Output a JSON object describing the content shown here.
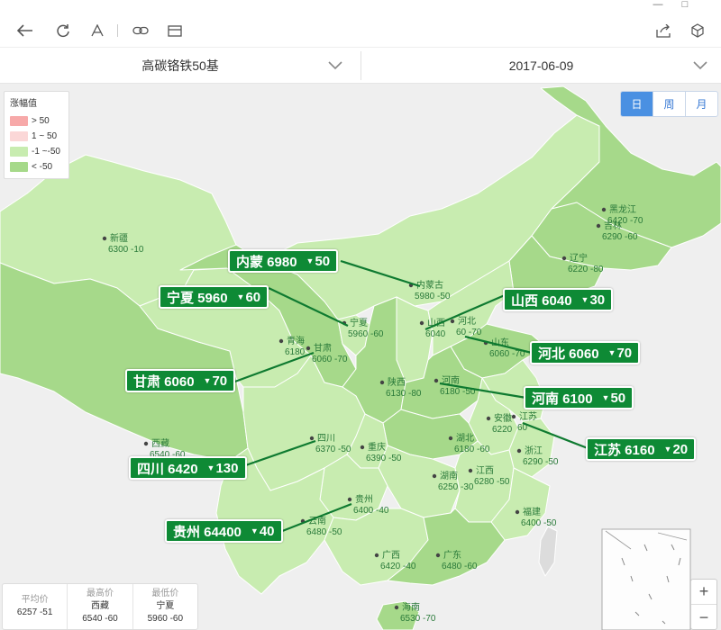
{
  "toolbar": {
    "window_controls": [
      "—",
      "□"
    ],
    "icons": [
      "back-icon",
      "refresh-icon",
      "font-icon",
      "link-icon",
      "card-icon",
      "share-icon",
      "cube-icon"
    ]
  },
  "selectors": {
    "product": "高碳铬铁50基",
    "date": "2017-06-09"
  },
  "legend": {
    "title": "涨幅值",
    "items": [
      {
        "label": "> 50",
        "color": "#f7a9a9"
      },
      {
        "label": "1 ~ 50",
        "color": "#fbd7d7"
      },
      {
        "label": "-1 ~-50",
        "color": "#c8ecb0"
      },
      {
        "label": "< -50",
        "color": "#a6d98a"
      }
    ]
  },
  "period_tabs": [
    {
      "label": "日",
      "active": true
    },
    {
      "label": "周",
      "active": false
    },
    {
      "label": "月",
      "active": false
    }
  ],
  "stats": [
    {
      "label": "平均价",
      "sub": "",
      "value": "6257 -51"
    },
    {
      "label": "最高价",
      "sub": "西藏",
      "value": "6540 -60"
    },
    {
      "label": "最低价",
      "sub": "宁夏",
      "value": "5960 -60"
    }
  ],
  "zoom": {
    "in": "+",
    "out": "−"
  },
  "provinces": [
    {
      "name": "新疆",
      "value": "6300 -10"
    },
    {
      "name": "内蒙古",
      "value": "5980 -50"
    },
    {
      "name": "黑龙江",
      "value": "6420 -70"
    },
    {
      "name": "吉林",
      "value": "6290 -60"
    },
    {
      "name": "辽宁",
      "value": "6220 -80"
    },
    {
      "name": "宁夏",
      "value": "5960 -60"
    },
    {
      "name": "山西",
      "value": "6040"
    },
    {
      "name": "河北",
      "value": "60 -70"
    },
    {
      "name": "山东",
      "value": "6060 -70"
    },
    {
      "name": "青海",
      "value": "6180"
    },
    {
      "name": "甘肃",
      "value": "6060 -70"
    },
    {
      "name": "陕西",
      "value": "6130 -80"
    },
    {
      "name": "河南",
      "value": "6180 -50"
    },
    {
      "name": "安徽",
      "value": "6220"
    },
    {
      "name": "江苏",
      "value": "60"
    },
    {
      "name": "西藏",
      "value": "6540 -60"
    },
    {
      "name": "四川",
      "value": "6370 -50"
    },
    {
      "name": "重庆",
      "value": "6390 -50"
    },
    {
      "name": "湖北",
      "value": "6180 -60"
    },
    {
      "name": "浙江",
      "value": "6290 -50"
    },
    {
      "name": "湖南",
      "value": "6250 -30"
    },
    {
      "name": "江西",
      "value": "6280 -50"
    },
    {
      "name": "贵州",
      "value": "6400 -40"
    },
    {
      "name": "云南",
      "value": "6480 -50"
    },
    {
      "name": "福建",
      "value": "6400 -50"
    },
    {
      "name": "广西",
      "value": "6420 -40"
    },
    {
      "name": "广东",
      "value": "6480 -60"
    },
    {
      "name": "海南",
      "value": "6530 -70"
    }
  ],
  "callouts": [
    {
      "name": "内蒙",
      "price": "6980",
      "change": "50"
    },
    {
      "name": "宁夏",
      "price": "5960",
      "change": "60"
    },
    {
      "name": "山西",
      "price": "6040",
      "change": "30"
    },
    {
      "name": "河北",
      "price": "6060",
      "change": "70"
    },
    {
      "name": "甘肃",
      "price": "6060",
      "change": "70"
    },
    {
      "name": "河南",
      "price": "6100",
      "change": "50"
    },
    {
      "name": "江苏",
      "price": "6160",
      "change": "20"
    },
    {
      "name": "四川",
      "price": "6420",
      "change": "130"
    },
    {
      "name": "贵州",
      "price": "64400",
      "change": "40"
    }
  ],
  "arrow_glyph": "▼"
}
